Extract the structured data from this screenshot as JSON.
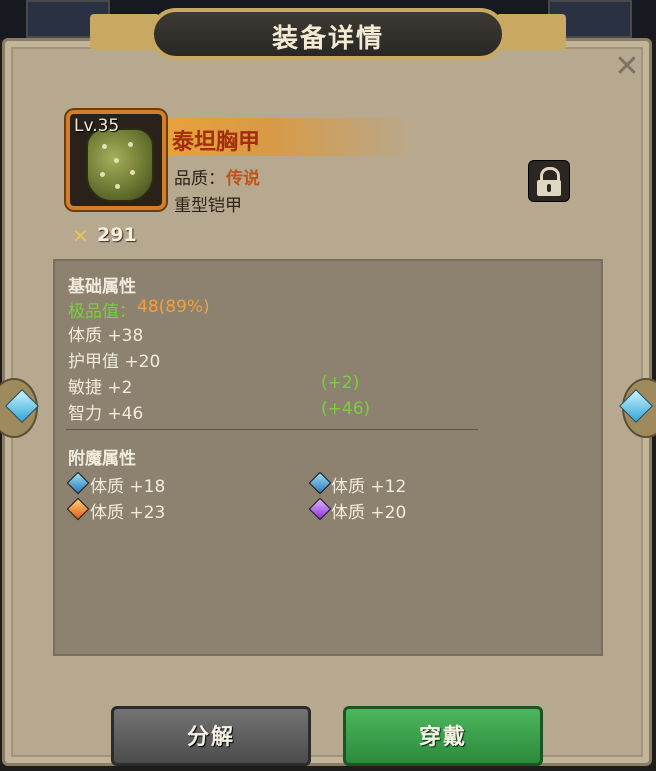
{
  "dialog": {
    "title": "装备详情",
    "close_icon": "close-icon"
  },
  "item": {
    "level": "Lv.35",
    "name": "泰坦胸甲",
    "quality_label": "品质：",
    "quality_value": "传说",
    "type": "重型铠甲",
    "power": "291",
    "icon": "chest-armor-icon",
    "locked": true
  },
  "base_attributes": {
    "header": "基础属性",
    "perfect_label": "极品值：",
    "perfect_value": "48(89%)",
    "rows": [
      {
        "label": "体质 +38",
        "bonus": ""
      },
      {
        "label": "护甲值 +20",
        "bonus": ""
      },
      {
        "label": "敏捷 +2",
        "bonus": "(+2)"
      },
      {
        "label": "智力 +46",
        "bonus": "(+46)"
      }
    ]
  },
  "enchant_attributes": {
    "header": "附魔属性",
    "items": [
      {
        "label": "体质 +18",
        "gem": "blue"
      },
      {
        "label": "体质 +12",
        "gem": "blue"
      },
      {
        "label": "体质 +23",
        "gem": "orange"
      },
      {
        "label": "体质 +20",
        "gem": "purple"
      }
    ]
  },
  "buttons": {
    "dismantle": "分解",
    "equip": "穿戴"
  },
  "colors": {
    "quality": "#c1531a",
    "bonus": "#79d03a",
    "accent": "#d07f2a"
  }
}
